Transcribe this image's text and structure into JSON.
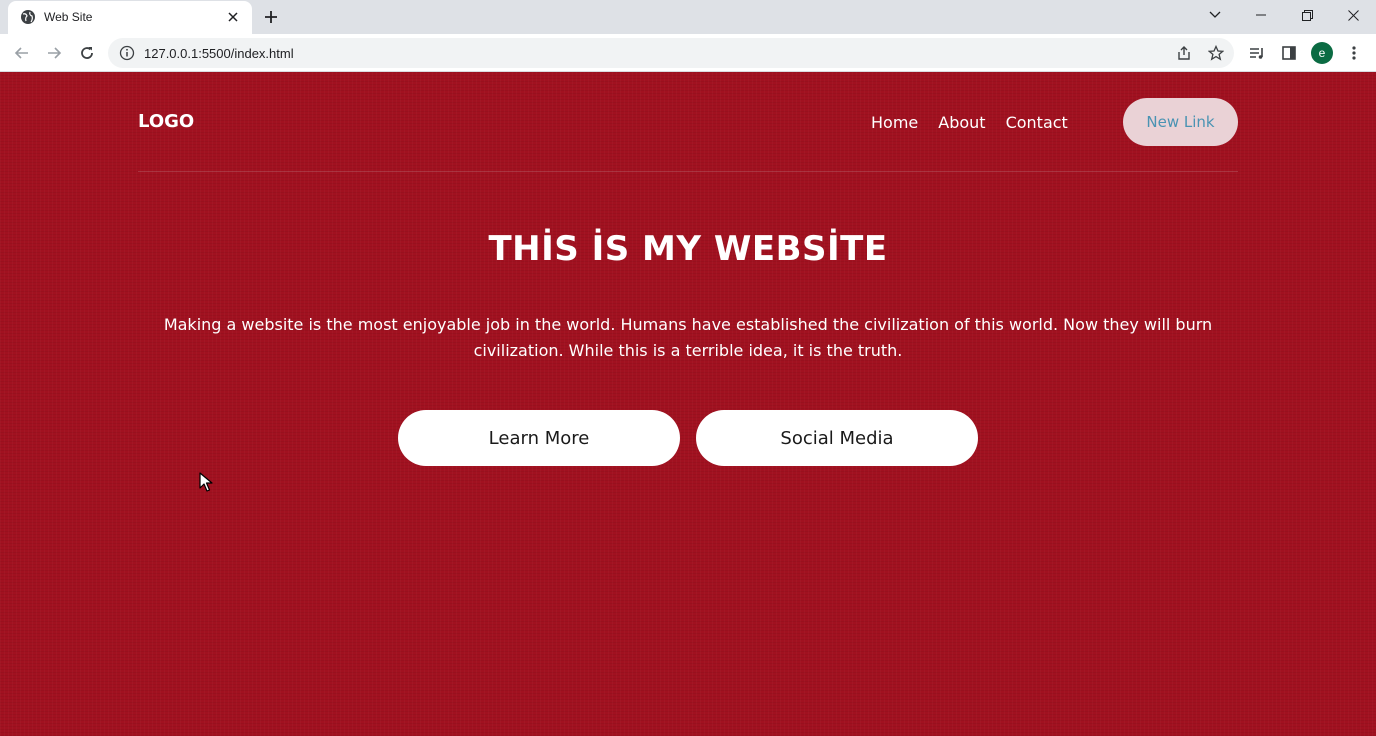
{
  "browser": {
    "tab_title": "Web Site",
    "url": "127.0.0.1:5500/index.html",
    "profile_initial": "e"
  },
  "page": {
    "logo": "LOGO",
    "nav": [
      "Home",
      "About",
      "Contact"
    ],
    "new_link": "New Link",
    "title": "THİS İS MY WEBSİTE",
    "description": "Making a website is the most enjoyable job in the world. Humans have established the civilization of this world. Now they will burn civilization. While this is a terrible idea, it is the truth.",
    "buttons": [
      "Learn More",
      "Social Media"
    ]
  },
  "colors": {
    "background": "#a11120",
    "new_link_bg": "#ead2d6",
    "new_link_text": "#4a93b3"
  }
}
